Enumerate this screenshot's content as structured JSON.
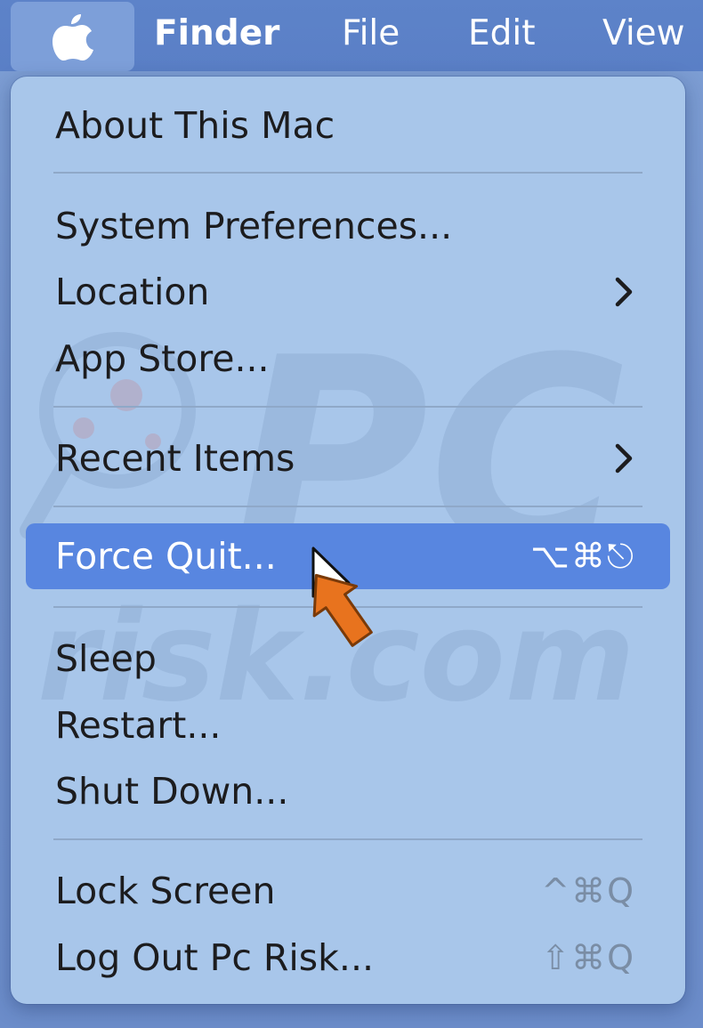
{
  "menubar": {
    "apple_icon": "apple-logo-icon",
    "app_name": "Finder",
    "file": "File",
    "edit": "Edit",
    "view": "View"
  },
  "menu": {
    "about": "About This Mac",
    "system_preferences": "System Preferences...",
    "location": "Location",
    "app_store": "App Store...",
    "recent_items": "Recent Items",
    "force_quit": "Force Quit...",
    "force_quit_shortcut": "⌥⌘⎋",
    "sleep": "Sleep",
    "restart": "Restart...",
    "shut_down": "Shut Down...",
    "lock_screen": "Lock Screen",
    "lock_screen_shortcut": "^⌘Q",
    "log_out": "Log Out Pc Risk...",
    "log_out_shortcut": "⇧⌘Q"
  },
  "watermark": {
    "text_top": "PC",
    "text_bottom": "risk.com"
  },
  "colors": {
    "menu_background": "#a8c6ea",
    "highlight": "#5886e0",
    "menubar": "#5d83c9",
    "cursor_accent": "#e8731e"
  }
}
